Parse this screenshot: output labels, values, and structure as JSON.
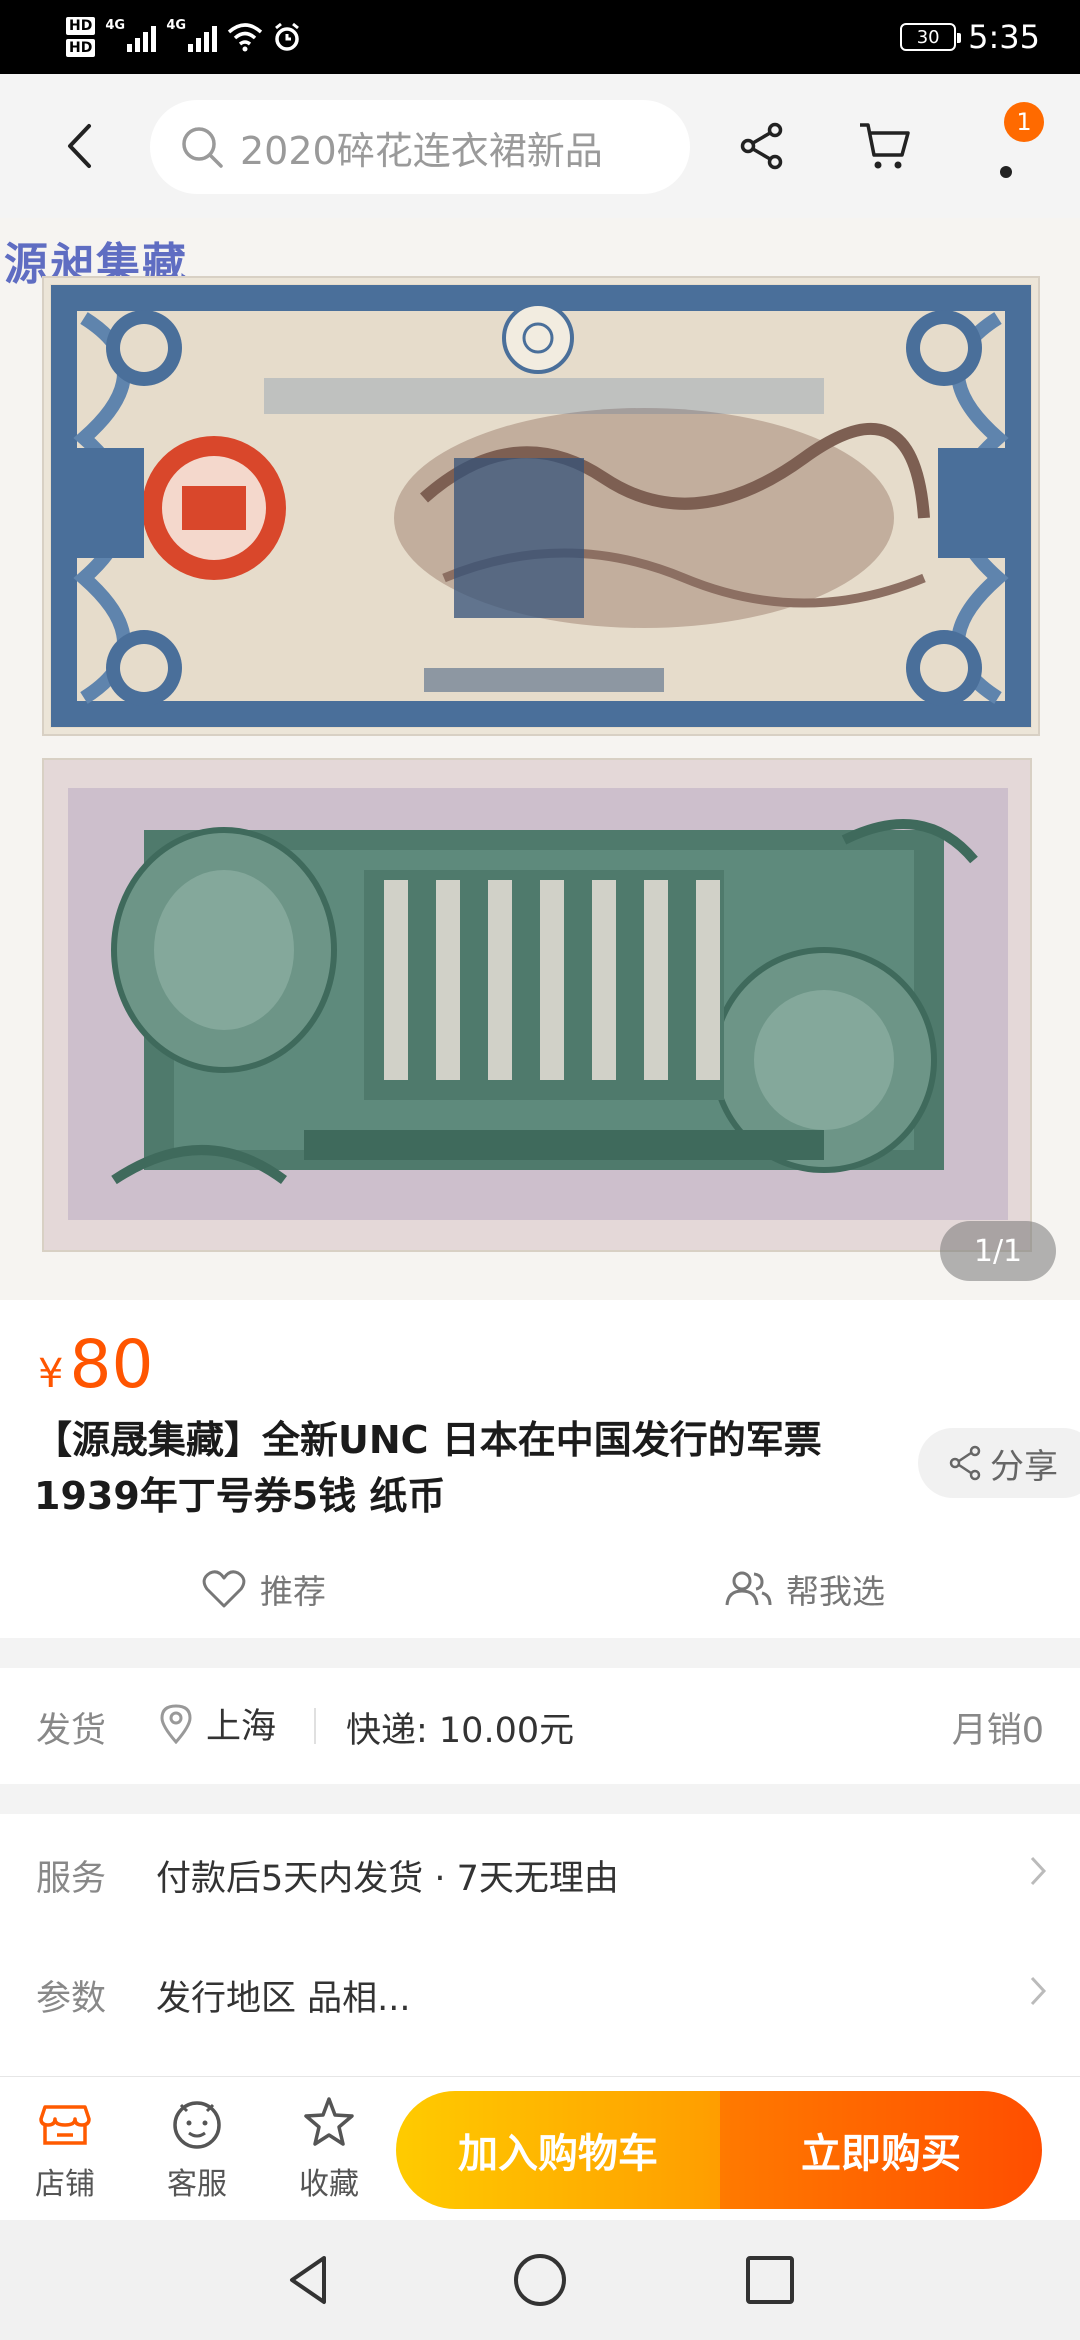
{
  "status_bar": {
    "hd1": "HD",
    "hd2": "HD",
    "net1": "4G",
    "net2": "4G",
    "battery": "30",
    "time": "5:35"
  },
  "topnav": {
    "search_placeholder": "2020碎花连衣裙新品",
    "cart_badge": "1",
    "icons": [
      "back-icon",
      "search-icon",
      "share-icon",
      "cart-icon",
      "more-icon"
    ]
  },
  "product_image": {
    "watermark": "源昶集藏",
    "pager": "1/1"
  },
  "product": {
    "currency": "¥",
    "price": "80",
    "title": "【源晟集藏】全新UNC 日本在中国发行的军票1939年丁号券5钱 纸币",
    "share_label": "分享",
    "recommend_label": "推荐",
    "help_choose_label": "帮我选"
  },
  "delivery": {
    "label": "发货",
    "location": "上海",
    "shipping": "快递: 10.00元",
    "monthly_sales": "月销0"
  },
  "service": {
    "service_label": "服务",
    "service_value": "付款后5天内发货 · 7天无理由",
    "params_label": "参数",
    "params_value": "发行地区 品相..."
  },
  "bottom_bar": {
    "shop_label": "店铺",
    "support_label": "客服",
    "favorite_label": "收藏",
    "add_cart_label": "加入购物车",
    "buy_now_label": "立即购买"
  },
  "colors": {
    "accent": "#ff5500",
    "cart_button": "#ffb300",
    "buy_button": "#ff5a00",
    "note_blue": "#4a6f9a",
    "note_green": "#4f7a6c",
    "seal_red": "#d9472b"
  }
}
